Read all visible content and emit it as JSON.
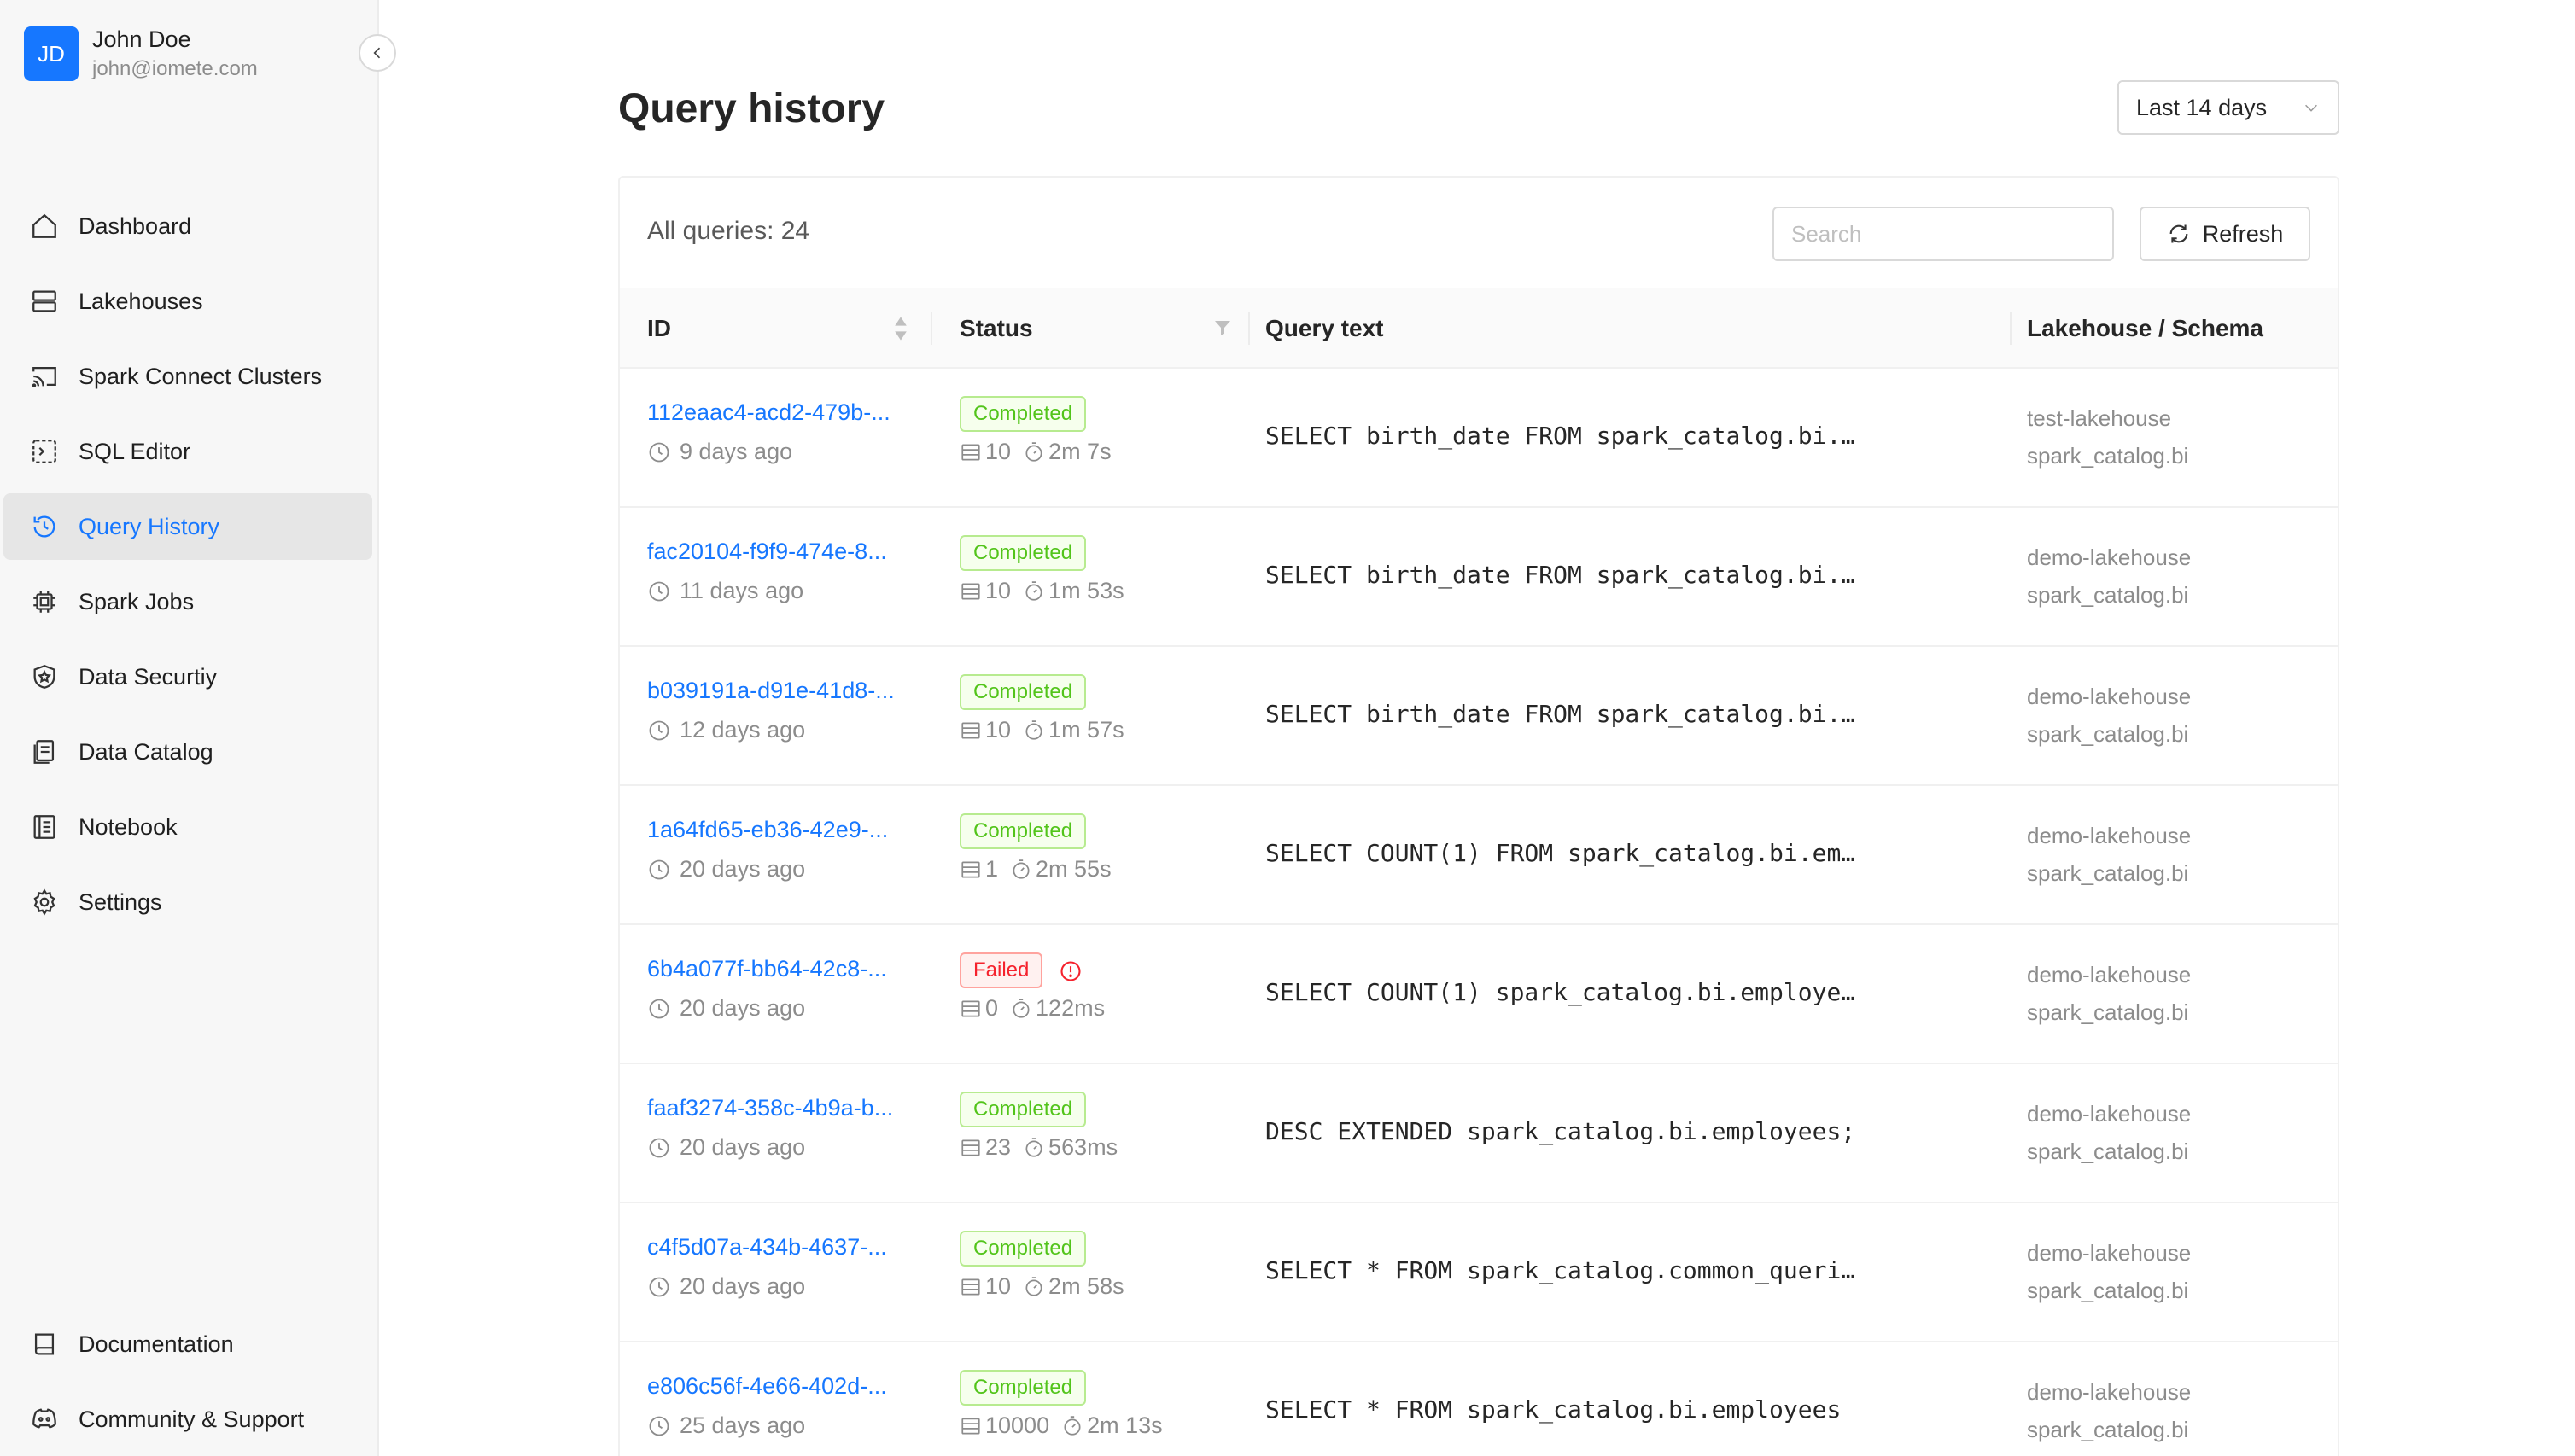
{
  "user": {
    "initials": "JD",
    "name": "John Doe",
    "email": "john@iomete.com"
  },
  "nav": [
    {
      "label": "Dashboard",
      "icon": "home-icon"
    },
    {
      "label": "Lakehouses",
      "icon": "server-icon"
    },
    {
      "label": "Spark Connect Clusters",
      "icon": "cast-icon"
    },
    {
      "label": "SQL Editor",
      "icon": "code-icon"
    },
    {
      "label": "Query History",
      "icon": "history-icon",
      "active": true
    },
    {
      "label": "Spark Jobs",
      "icon": "chip-icon"
    },
    {
      "label": "Data Securtiy",
      "icon": "shield-icon"
    },
    {
      "label": "Data Catalog",
      "icon": "catalog-icon"
    },
    {
      "label": "Notebook",
      "icon": "notebook-icon"
    },
    {
      "label": "Settings",
      "icon": "gear-icon"
    }
  ],
  "nav_bottom": [
    {
      "label": "Documentation",
      "icon": "book-icon"
    },
    {
      "label": "Community & Support",
      "icon": "discord-icon"
    }
  ],
  "page": {
    "title": "Query history",
    "range": "Last 14 days"
  },
  "table": {
    "count_label": "All queries: 24",
    "search_placeholder": "Search",
    "refresh_label": "Refresh",
    "headers": {
      "id": "ID",
      "status": "Status",
      "query": "Query text",
      "lakehouse": "Lakehouse / Schema"
    },
    "rows": [
      {
        "id": "112eaac4-acd2-479b-...",
        "time": "9 days ago",
        "status": "Completed",
        "ok": true,
        "rows": "10",
        "duration": "2m 7s",
        "query": "SELECT birth_date FROM spark_catalog.bi.…",
        "lakehouse": "test-lakehouse",
        "schema": "spark_catalog.bi"
      },
      {
        "id": "fac20104-f9f9-474e-8...",
        "time": "11 days ago",
        "status": "Completed",
        "ok": true,
        "rows": "10",
        "duration": "1m 53s",
        "query": "SELECT birth_date FROM spark_catalog.bi.…",
        "lakehouse": "demo-lakehouse",
        "schema": "spark_catalog.bi"
      },
      {
        "id": "b039191a-d91e-41d8-...",
        "time": "12 days ago",
        "status": "Completed",
        "ok": true,
        "rows": "10",
        "duration": "1m 57s",
        "query": "SELECT birth_date FROM spark_catalog.bi.…",
        "lakehouse": "demo-lakehouse",
        "schema": "spark_catalog.bi"
      },
      {
        "id": "1a64fd65-eb36-42e9-...",
        "time": "20 days ago",
        "status": "Completed",
        "ok": true,
        "rows": "1",
        "duration": "2m 55s",
        "query": "SELECT COUNT(1) FROM spark_catalog.bi.em…",
        "lakehouse": "demo-lakehouse",
        "schema": "spark_catalog.bi"
      },
      {
        "id": "6b4a077f-bb64-42c8-...",
        "time": "20 days ago",
        "status": "Failed",
        "ok": false,
        "rows": "0",
        "duration": "122ms",
        "query": "SELECT COUNT(1) spark_catalog.bi.employe…",
        "lakehouse": "demo-lakehouse",
        "schema": "spark_catalog.bi"
      },
      {
        "id": "faaf3274-358c-4b9a-b...",
        "time": "20 days ago",
        "status": "Completed",
        "ok": true,
        "rows": "23",
        "duration": "563ms",
        "query": "DESC EXTENDED spark_catalog.bi.employees;",
        "lakehouse": "demo-lakehouse",
        "schema": "spark_catalog.bi"
      },
      {
        "id": "c4f5d07a-434b-4637-...",
        "time": "20 days ago",
        "status": "Completed",
        "ok": true,
        "rows": "10",
        "duration": "2m 58s",
        "query": "SELECT * FROM spark_catalog.common_queri…",
        "lakehouse": "demo-lakehouse",
        "schema": "spark_catalog.bi"
      },
      {
        "id": "e806c56f-4e66-402d-...",
        "time": "25 days ago",
        "status": "Completed",
        "ok": true,
        "rows": "10000",
        "duration": "2m 13s",
        "query": "SELECT * FROM spark_catalog.bi.employees",
        "lakehouse": "demo-lakehouse",
        "schema": "spark_catalog.bi"
      }
    ]
  },
  "colors": {
    "accent": "#1677ff",
    "success": "#52c41a",
    "error": "#f5222d"
  }
}
